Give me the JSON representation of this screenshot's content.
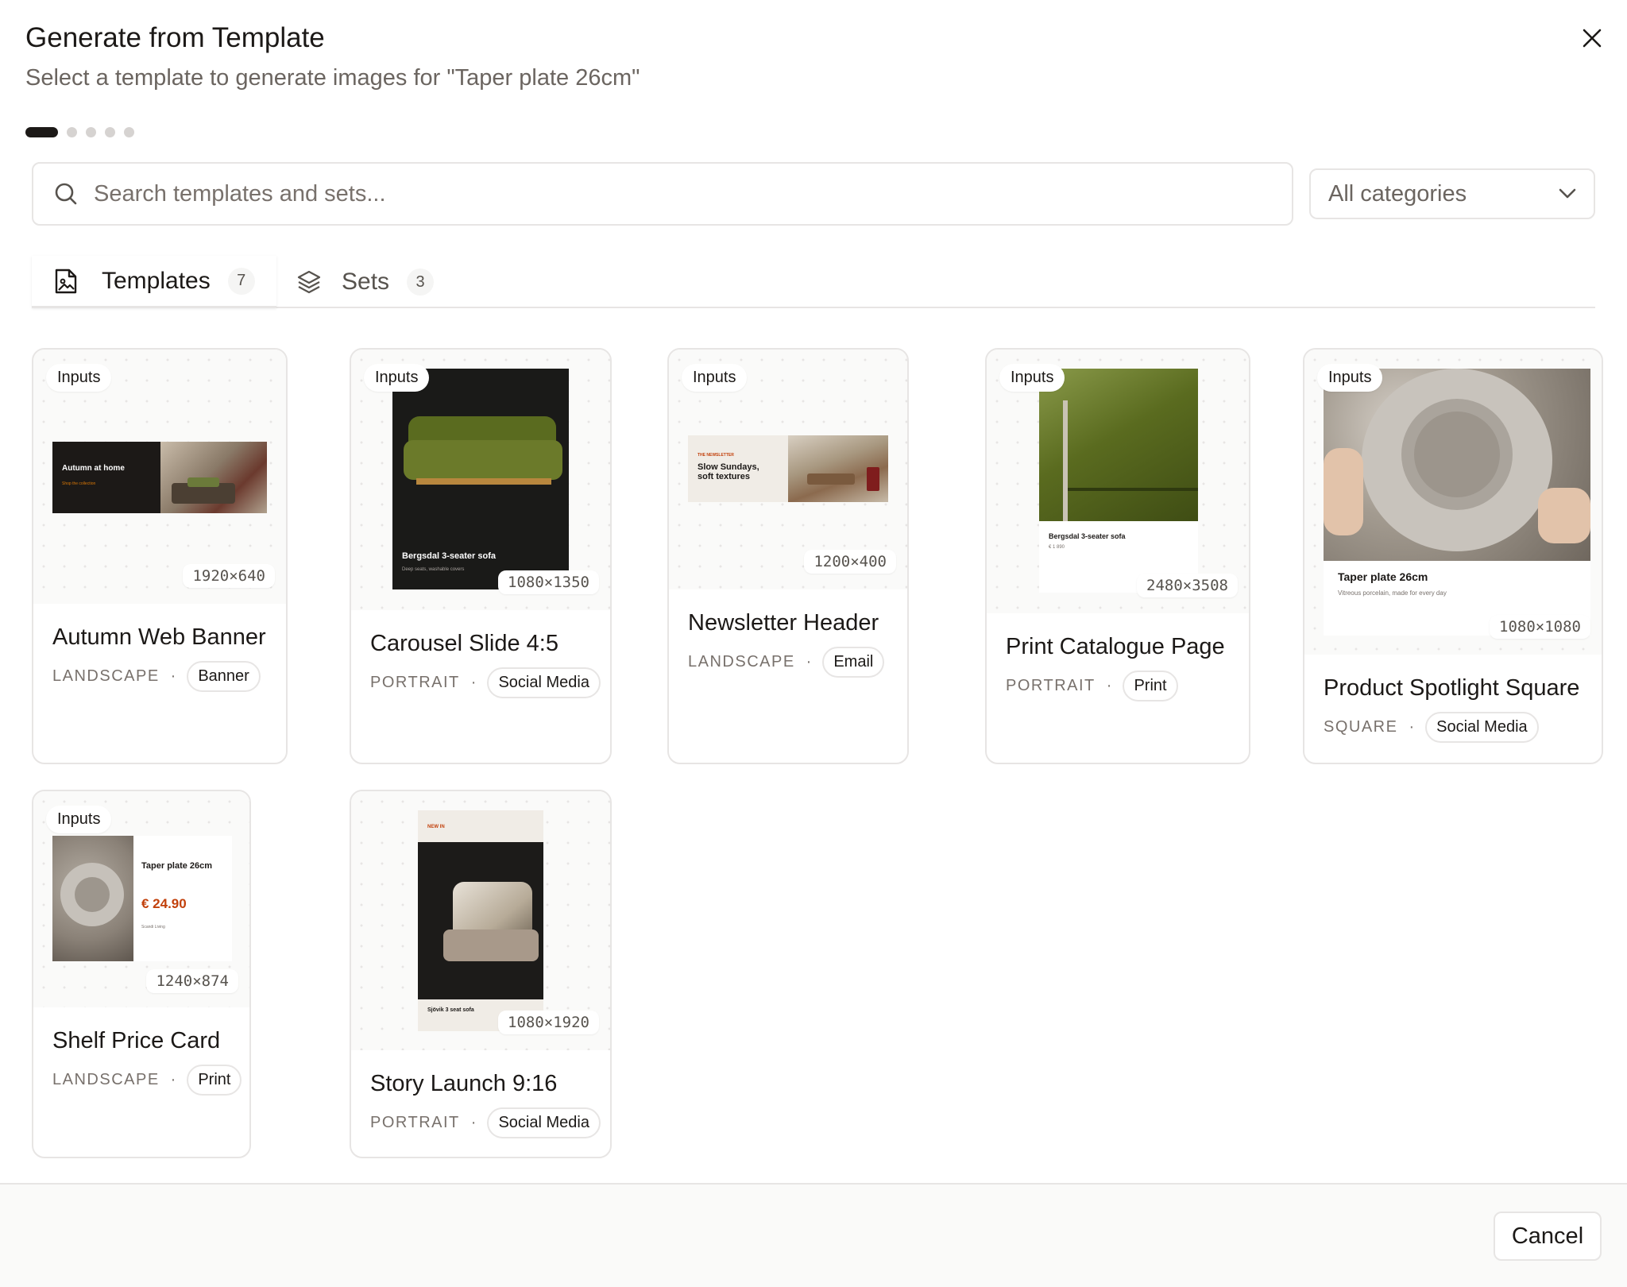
{
  "dialog": {
    "title": "Generate from Template",
    "subtitle": "Select a template to generate images for \"Taper plate 26cm\""
  },
  "stepper": {
    "current": 1,
    "total": 5
  },
  "search": {
    "placeholder": "Search templates and sets...",
    "value": ""
  },
  "category_filter": {
    "selected": "All categories"
  },
  "tabs": [
    {
      "label": "Templates",
      "count": "7",
      "active": true
    },
    {
      "label": "Sets",
      "count": "3",
      "active": false
    }
  ],
  "templates": [
    {
      "title": "Autumn Web Banner",
      "orientation": "LANDSCAPE",
      "category": "Banner",
      "dimensions": "1920×640",
      "badge": "Inputs",
      "thumb": {
        "headline": "Autumn at home",
        "cta": "Shop the collection"
      }
    },
    {
      "title": "Carousel Slide 4:5",
      "orientation": "PORTRAIT",
      "category": "Social Media",
      "dimensions": "1080×1350",
      "badge": "Inputs",
      "thumb": {
        "headline": "Bergsdal 3-seater sofa",
        "sub": "Deep seats, washable covers"
      }
    },
    {
      "title": "Newsletter Header",
      "orientation": "LANDSCAPE",
      "category": "Email",
      "dimensions": "1200×400",
      "badge": "Inputs",
      "thumb": {
        "kicker": "THE NEWSLETTER",
        "headline": "Slow Sundays, soft textures"
      }
    },
    {
      "title": "Print Catalogue Page",
      "orientation": "PORTRAIT",
      "category": "Print",
      "dimensions": "2480×3508",
      "badge": "Inputs",
      "thumb": {
        "headline": "Bergsdal 3-seater sofa",
        "price": "€ 1 890"
      }
    },
    {
      "title": "Product Spotlight Square",
      "orientation": "SQUARE",
      "category": "Social Media",
      "dimensions": "1080×1080",
      "badge": "Inputs",
      "thumb": {
        "headline": "Taper plate 26cm",
        "sub": "Vitreous porcelain, made for every day"
      }
    },
    {
      "title": "Shelf Price Card",
      "orientation": "LANDSCAPE",
      "category": "Print",
      "dimensions": "1240×874",
      "badge": "Inputs",
      "thumb": {
        "headline": "Taper plate 26cm",
        "price": "€ 24.90",
        "brand": "Scandi Living"
      }
    },
    {
      "title": "Story Launch 9:16",
      "orientation": "PORTRAIT",
      "category": "Social Media",
      "dimensions": "1080×1920",
      "badge": "",
      "thumb": {
        "kicker": "NEW IN",
        "headline": "Sjövik 3 seat sofa"
      }
    }
  ],
  "footer": {
    "cancel_label": "Cancel"
  },
  "colors": {
    "accent": "#1c1917",
    "border": "#e7e5e4",
    "muted": "#78716c",
    "price": "#c2410c",
    "olive": "#5a6b1f"
  },
  "icons": [
    "close-icon",
    "search-icon",
    "chevron-down-icon",
    "template-file-icon",
    "layers-icon"
  ]
}
